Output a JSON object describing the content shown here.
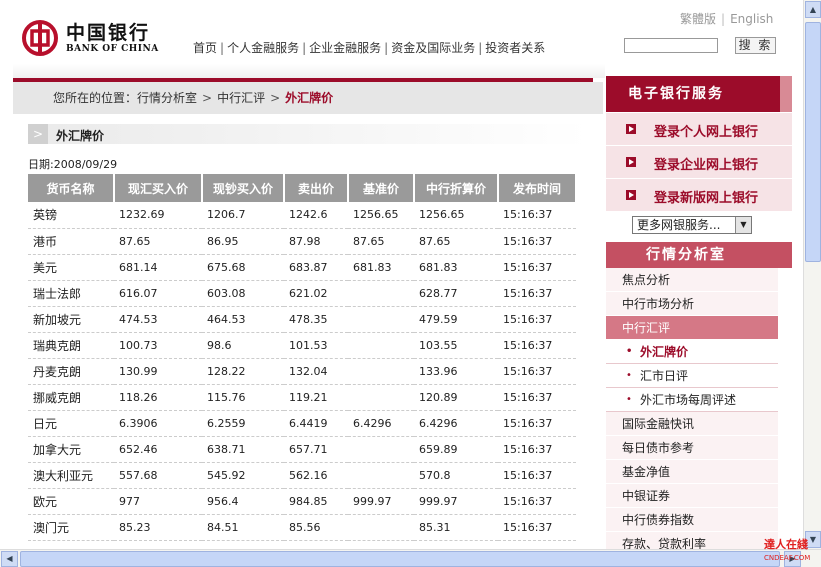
{
  "header": {
    "logo_cn": "中国银行",
    "logo_en": "BANK OF CHINA",
    "nav": [
      "首页",
      "个人金融服务",
      "企业金融服务",
      "资金及国际业务",
      "投资者关系"
    ],
    "lang_trad": "繁體版",
    "lang_en": "English",
    "search_button": "搜 索",
    "search_value": ""
  },
  "breadcrumb": {
    "prefix": "您所在的位置：",
    "items": [
      "行情分析室",
      "中行汇评"
    ],
    "current": "外汇牌价"
  },
  "section": {
    "title": "外汇牌价",
    "date": "日期:2008/09/29"
  },
  "table": {
    "headers": [
      "货币名称",
      "现汇买入价",
      "现钞买入价",
      "卖出价",
      "基准价",
      "中行折算价",
      "发布时间"
    ],
    "rows": [
      [
        "英镑",
        "1232.69",
        "1206.7",
        "1242.6",
        "1256.65",
        "1256.65",
        "15:16:37"
      ],
      [
        "港币",
        "87.65",
        "86.95",
        "87.98",
        "87.65",
        "87.65",
        "15:16:37"
      ],
      [
        "美元",
        "681.14",
        "675.68",
        "683.87",
        "681.83",
        "681.83",
        "15:16:37"
      ],
      [
        "瑞士法郎",
        "616.07",
        "603.08",
        "621.02",
        "",
        "628.77",
        "15:16:37"
      ],
      [
        "新加坡元",
        "474.53",
        "464.53",
        "478.35",
        "",
        "479.59",
        "15:16:37"
      ],
      [
        "瑞典克朗",
        "100.73",
        "98.6",
        "101.53",
        "",
        "103.55",
        "15:16:37"
      ],
      [
        "丹麦克朗",
        "130.99",
        "128.22",
        "132.04",
        "",
        "133.96",
        "15:16:37"
      ],
      [
        "挪威克朗",
        "118.26",
        "115.76",
        "119.21",
        "",
        "120.89",
        "15:16:37"
      ],
      [
        "日元",
        "6.3906",
        "6.2559",
        "6.4419",
        "6.4296",
        "6.4296",
        "15:16:37"
      ],
      [
        "加拿大元",
        "652.46",
        "638.71",
        "657.71",
        "",
        "659.89",
        "15:16:37"
      ],
      [
        "澳大利亚元",
        "557.68",
        "545.92",
        "562.16",
        "",
        "570.8",
        "15:16:37"
      ],
      [
        "欧元",
        "977",
        "956.4",
        "984.85",
        "999.97",
        "999.97",
        "15:16:37"
      ],
      [
        "澳门元",
        "85.23",
        "84.51",
        "85.56",
        "",
        "85.31",
        "15:16:37"
      ]
    ]
  },
  "sidebar": {
    "ebank_title": "电子银行服务",
    "ebank_links": [
      "登录个人网上银行",
      "登录企业网上银行",
      "登录新版网上银行"
    ],
    "more_select": "更多网银服务...",
    "market_title": "行情分析室",
    "menu": [
      "焦点分析",
      "中行市场分析",
      "中行汇评"
    ],
    "submenu": [
      "外汇牌价",
      "汇市日评",
      "外汇市场每周评述"
    ],
    "menu2": [
      "国际金融快讯",
      "每日债市参考",
      "基金净值",
      "中银证券",
      "中行债券指数",
      "存款、贷款利率"
    ]
  },
  "watermark": {
    "line1": "達人在綫",
    "line2": "CNDEAF.COM"
  }
}
